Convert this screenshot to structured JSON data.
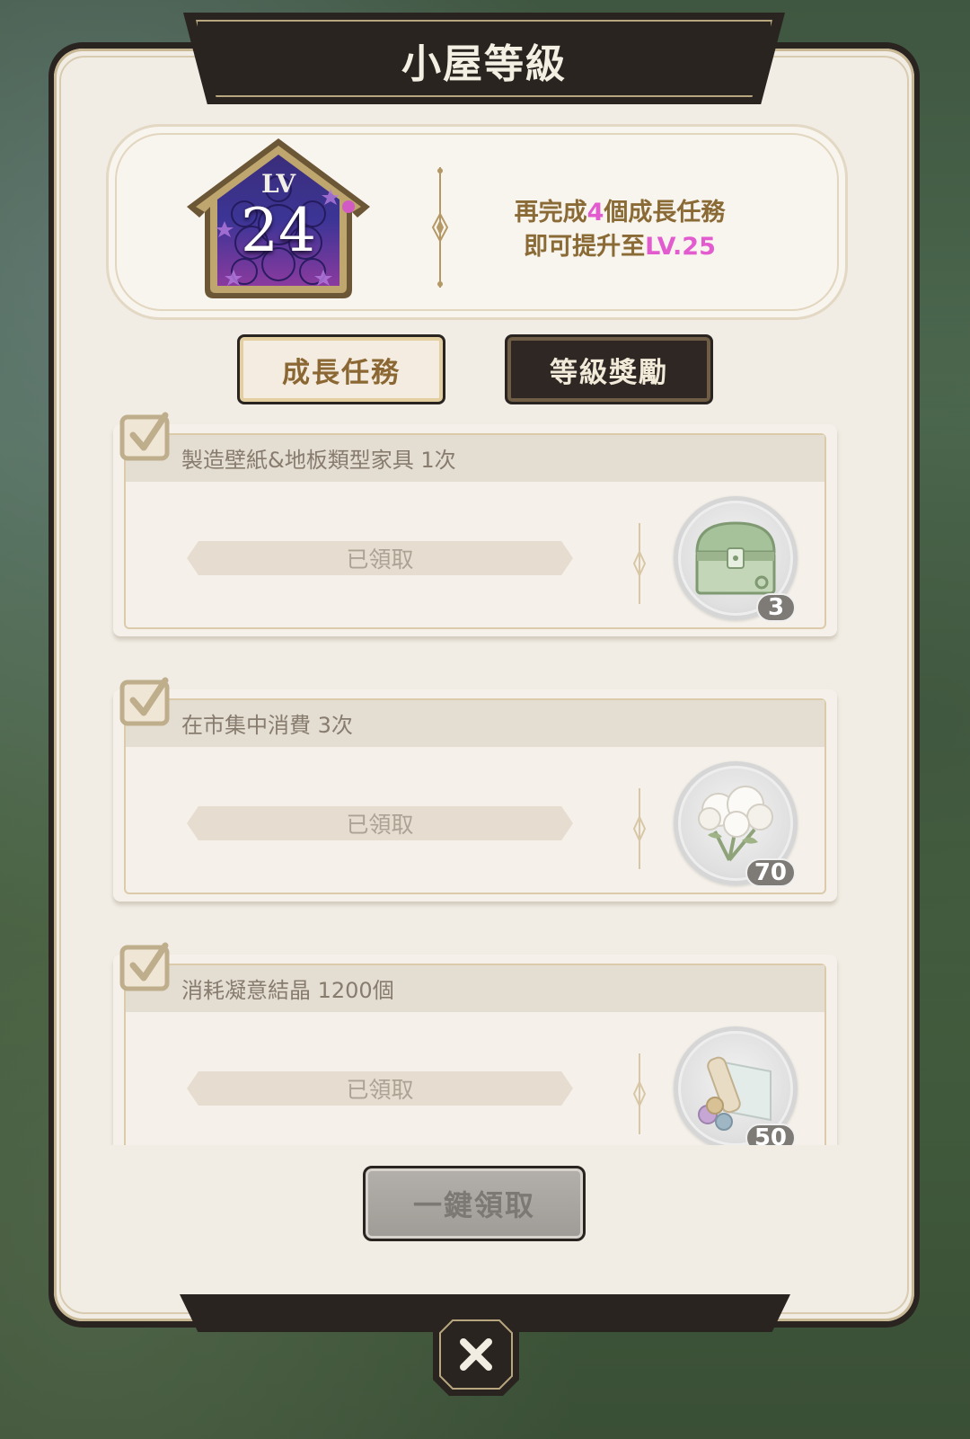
{
  "title": "小屋等級",
  "level": {
    "prefix": "LV",
    "number": "24",
    "info_line1_pre": "再完成",
    "info_line1_count": "4",
    "info_line1_post": "個成長任務",
    "info_line2_pre": "即可提升至",
    "info_line2_target": "LV.25"
  },
  "tabs": [
    {
      "label": "成長任務",
      "active": true
    },
    {
      "label": "等級獎勵",
      "active": false
    }
  ],
  "tasks": [
    {
      "title": "製造壁紙&地板類型家具 1次",
      "status": "已領取",
      "reward_icon": "treasure-chest-icon",
      "reward_count": "3"
    },
    {
      "title": "在市集中消費 3次",
      "status": "已領取",
      "reward_icon": "cotton-flower-icon",
      "reward_count": "70"
    },
    {
      "title": "消耗凝意結晶 1200個",
      "status": "已領取",
      "reward_icon": "cloth-roll-icon",
      "reward_count": "50"
    }
  ],
  "collect_all_label": "一鍵領取",
  "colors": {
    "accent_pink": "#e25bcf",
    "gold_text": "#8a6a35",
    "panel_dark": "#2a2421",
    "panel_bg": "#f1ede5"
  }
}
